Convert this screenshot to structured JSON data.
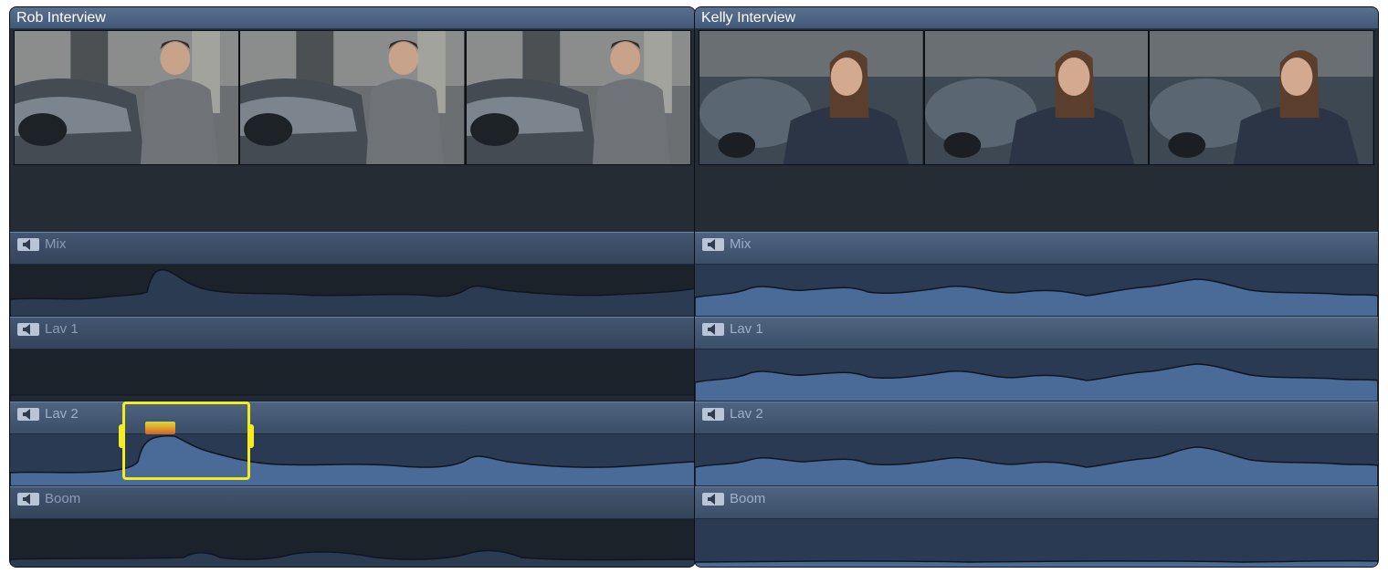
{
  "clips": [
    {
      "title": "Rob Interview",
      "lanes": [
        {
          "label": "Mix"
        },
        {
          "label": "Lav 1"
        },
        {
          "label": "Lav 2"
        },
        {
          "label": "Boom"
        }
      ]
    },
    {
      "title": "Kelly Interview",
      "lanes": [
        {
          "label": "Mix"
        },
        {
          "label": "Lav 1"
        },
        {
          "label": "Lav 2"
        },
        {
          "label": "Boom"
        }
      ]
    }
  ],
  "colors": {
    "selection": "#f3ec1f",
    "lane_header": "#4f6480",
    "waveform_active": "#4a6a97",
    "waveform_inactive": "#2b3b52"
  },
  "icons": {
    "lane_speaker": "speaker-icon"
  }
}
